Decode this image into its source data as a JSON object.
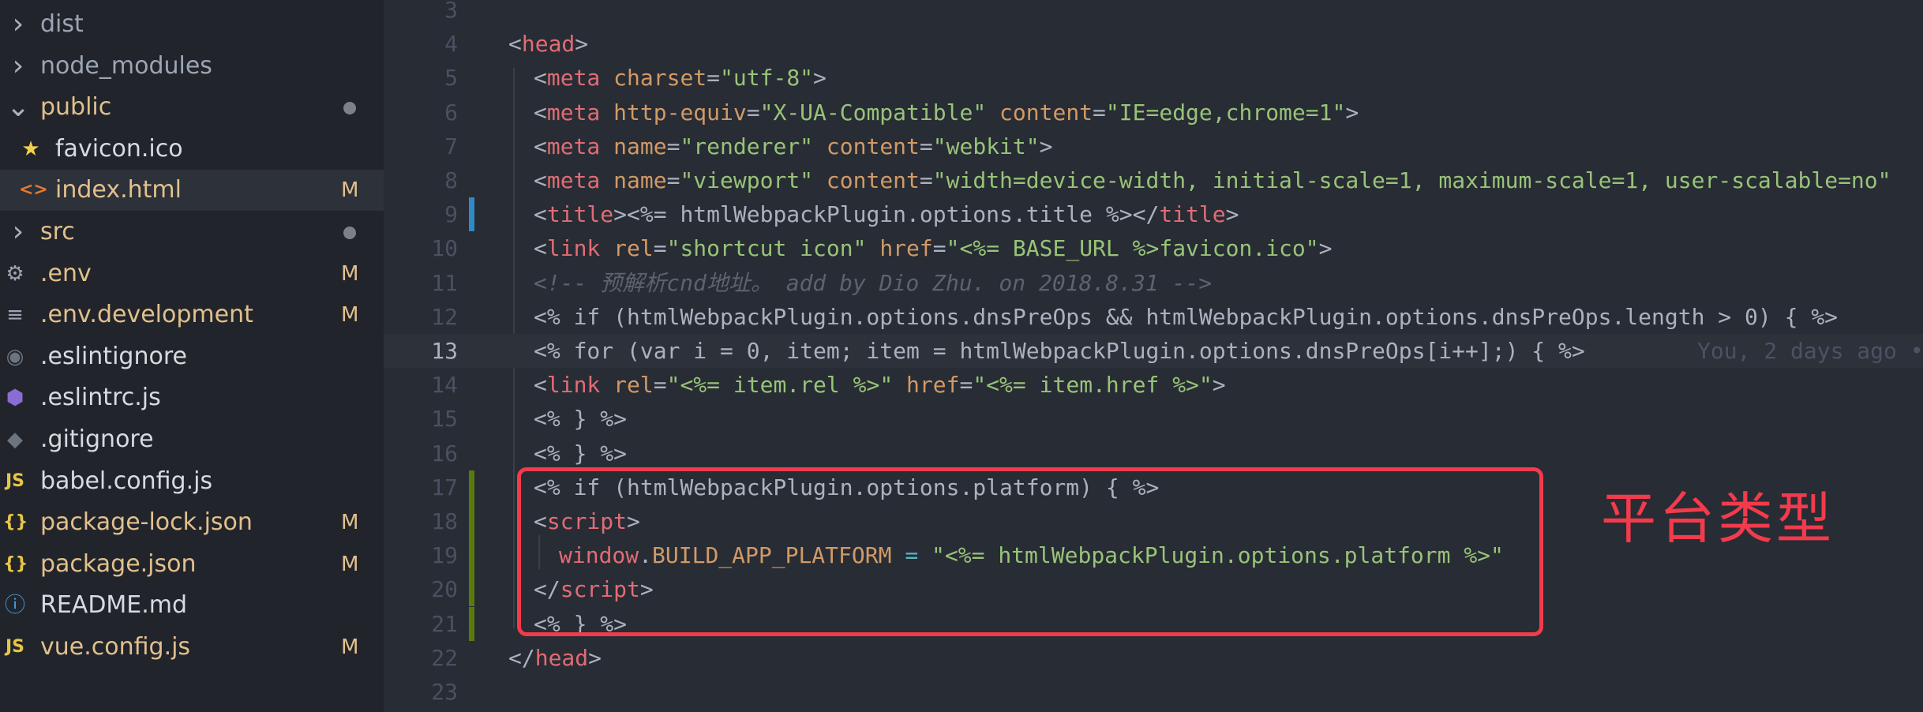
{
  "explorer": {
    "items": [
      {
        "name": "dist",
        "kind": "folder-collapsed",
        "icon": "chevron-right-icon",
        "color": "#9da5b4",
        "badge": ""
      },
      {
        "name": "node_modules",
        "kind": "folder-collapsed",
        "icon": "chevron-right-icon",
        "color": "#9da5b4",
        "badge": ""
      },
      {
        "name": "public",
        "kind": "folder-expanded",
        "icon": "chevron-down-icon",
        "color": "#e2c08d",
        "badge": "dot"
      },
      {
        "name": "favicon.ico",
        "kind": "file",
        "icon": "star-icon",
        "color": "#d7dae0",
        "badge": ""
      },
      {
        "name": "index.html",
        "kind": "file",
        "icon": "html-icon",
        "color": "#e2c08d",
        "badge": "M",
        "selected": true
      },
      {
        "name": "src",
        "kind": "folder-collapsed",
        "icon": "chevron-right-icon",
        "color": "#e2c08d",
        "badge": "dot"
      },
      {
        "name": ".env",
        "kind": "file",
        "icon": "gear-icon",
        "color": "#e2c08d",
        "badge": "M"
      },
      {
        "name": ".env.development",
        "kind": "file",
        "icon": "lines-icon",
        "color": "#e2c08d",
        "badge": "M"
      },
      {
        "name": ".eslintignore",
        "kind": "file",
        "icon": "circle-icon",
        "color": "#d7dae0",
        "badge": ""
      },
      {
        "name": ".eslintrc.js",
        "kind": "file",
        "icon": "eslint-icon",
        "color": "#d7dae0",
        "badge": ""
      },
      {
        "name": ".gitignore",
        "kind": "file",
        "icon": "git-icon",
        "color": "#d7dae0",
        "badge": ""
      },
      {
        "name": "babel.config.js",
        "kind": "file",
        "icon": "js-icon",
        "color": "#d7dae0",
        "badge": ""
      },
      {
        "name": "package-lock.json",
        "kind": "file",
        "icon": "json-icon",
        "color": "#e2c08d",
        "badge": "M"
      },
      {
        "name": "package.json",
        "kind": "file",
        "icon": "json-icon",
        "color": "#e2c08d",
        "badge": "M"
      },
      {
        "name": "README.md",
        "kind": "file",
        "icon": "info-icon",
        "color": "#d7dae0",
        "badge": ""
      },
      {
        "name": "vue.config.js",
        "kind": "file",
        "icon": "js-icon",
        "color": "#e2c08d",
        "badge": "M"
      }
    ]
  },
  "editor": {
    "current_line": 13,
    "lines": [
      {
        "num": "3",
        "indent": 0,
        "tokens": []
      },
      {
        "num": "4",
        "indent": 0,
        "tokens": [
          [
            "p",
            "<"
          ],
          [
            "t",
            "head"
          ],
          [
            "p",
            ">"
          ]
        ]
      },
      {
        "num": "5",
        "indent": 1,
        "tokens": [
          [
            "p",
            "<"
          ],
          [
            "t",
            "meta"
          ],
          [
            "p",
            " "
          ],
          [
            "a",
            "charset"
          ],
          [
            "p",
            "="
          ],
          [
            "s",
            "\"utf-8\""
          ],
          [
            "p",
            ">"
          ]
        ]
      },
      {
        "num": "6",
        "indent": 1,
        "tokens": [
          [
            "p",
            "<"
          ],
          [
            "t",
            "meta"
          ],
          [
            "p",
            " "
          ],
          [
            "a",
            "http-equiv"
          ],
          [
            "p",
            "="
          ],
          [
            "s",
            "\"X-UA-Compatible\""
          ],
          [
            "p",
            " "
          ],
          [
            "a",
            "content"
          ],
          [
            "p",
            "="
          ],
          [
            "s",
            "\"IE=edge,chrome=1\""
          ],
          [
            "p",
            ">"
          ]
        ]
      },
      {
        "num": "7",
        "indent": 1,
        "tokens": [
          [
            "p",
            "<"
          ],
          [
            "t",
            "meta"
          ],
          [
            "p",
            " "
          ],
          [
            "a",
            "name"
          ],
          [
            "p",
            "="
          ],
          [
            "s",
            "\"renderer\""
          ],
          [
            "p",
            " "
          ],
          [
            "a",
            "content"
          ],
          [
            "p",
            "="
          ],
          [
            "s",
            "\"webkit\""
          ],
          [
            "p",
            ">"
          ]
        ]
      },
      {
        "num": "8",
        "indent": 1,
        "tokens": [
          [
            "p",
            "<"
          ],
          [
            "t",
            "meta"
          ],
          [
            "p",
            " "
          ],
          [
            "a",
            "name"
          ],
          [
            "p",
            "="
          ],
          [
            "s",
            "\"viewport\""
          ],
          [
            "p",
            " "
          ],
          [
            "a",
            "content"
          ],
          [
            "p",
            "="
          ],
          [
            "s",
            "\"width=device-width, initial-scale=1, maximum-scale=1, user-scalable=no\""
          ]
        ]
      },
      {
        "num": "9",
        "indent": 1,
        "git": "#2f8ac5",
        "tokens": [
          [
            "p",
            "<"
          ],
          [
            "t",
            "title"
          ],
          [
            "p",
            ">"
          ],
          [
            "p",
            "<%= htmlWebpackPlugin.options.title %>"
          ],
          [
            "p",
            "</"
          ],
          [
            "t",
            "title"
          ],
          [
            "p",
            ">"
          ]
        ]
      },
      {
        "num": "10",
        "indent": 1,
        "tokens": [
          [
            "p",
            "<"
          ],
          [
            "t",
            "link"
          ],
          [
            "p",
            " "
          ],
          [
            "a",
            "rel"
          ],
          [
            "p",
            "="
          ],
          [
            "s",
            "\"shortcut icon\""
          ],
          [
            "p",
            " "
          ],
          [
            "a",
            "href"
          ],
          [
            "p",
            "="
          ],
          [
            "s",
            "\"<%= BASE_URL %>favicon.ico\""
          ],
          [
            "p",
            ">"
          ]
        ]
      },
      {
        "num": "11",
        "indent": 1,
        "tokens": [
          [
            "c",
            "<!-- 预解析cnd地址。 add by Dio Zhu. on 2018.8.31 -->"
          ]
        ]
      },
      {
        "num": "12",
        "indent": 1,
        "tokens": [
          [
            "p",
            "<% if (htmlWebpackPlugin.options.dnsPreOps && htmlWebpackPlugin.options.dnsPreOps.length > 0) { %>"
          ]
        ]
      },
      {
        "num": "13",
        "indent": 1,
        "current": true,
        "blame": "You, 2 days ago •",
        "tokens": [
          [
            "p",
            "<% for (var i = 0, item; item = htmlWebpackPlugin.options.dnsPreOps[i++];) { %>"
          ]
        ]
      },
      {
        "num": "14",
        "indent": 1,
        "tokens": [
          [
            "p",
            "<"
          ],
          [
            "t",
            "link"
          ],
          [
            "p",
            " "
          ],
          [
            "a",
            "rel"
          ],
          [
            "p",
            "="
          ],
          [
            "s",
            "\"<%= item.rel %>\""
          ],
          [
            "p",
            " "
          ],
          [
            "a",
            "href"
          ],
          [
            "p",
            "="
          ],
          [
            "s",
            "\"<%= item.href %>\""
          ],
          [
            "p",
            ">"
          ]
        ]
      },
      {
        "num": "15",
        "indent": 1,
        "tokens": [
          [
            "p",
            "<% } %>"
          ]
        ]
      },
      {
        "num": "16",
        "indent": 1,
        "tokens": [
          [
            "p",
            "<% } %>"
          ]
        ]
      },
      {
        "num": "17",
        "indent": 1,
        "git": "#587c0c",
        "tokens": [
          [
            "p",
            "<% if (htmlWebpackPlugin.options.platform) { %>"
          ]
        ]
      },
      {
        "num": "18",
        "indent": 1,
        "git": "#587c0c",
        "tokens": [
          [
            "p",
            "<"
          ],
          [
            "t",
            "script"
          ],
          [
            "p",
            ">"
          ]
        ]
      },
      {
        "num": "19",
        "indent": 2,
        "git": "#587c0c",
        "tokens": [
          [
            "t",
            "window"
          ],
          [
            "p",
            "."
          ],
          [
            "a",
            "BUILD_APP_PLATFORM"
          ],
          [
            "p",
            " "
          ],
          [
            "o",
            "="
          ],
          [
            "p",
            " "
          ],
          [
            "s",
            "\"<%= htmlWebpackPlugin.options.platform %>\""
          ]
        ]
      },
      {
        "num": "20",
        "indent": 1,
        "git": "#587c0c",
        "tokens": [
          [
            "p",
            "</"
          ],
          [
            "t",
            "script"
          ],
          [
            "p",
            ">"
          ]
        ]
      },
      {
        "num": "21",
        "indent": 1,
        "git": "#587c0c",
        "tokens": [
          [
            "p",
            "<% } %>"
          ]
        ]
      },
      {
        "num": "22",
        "indent": 0,
        "tokens": [
          [
            "p",
            "</"
          ],
          [
            "t",
            "head"
          ],
          [
            "p",
            ">"
          ]
        ]
      },
      {
        "num": "23",
        "indent": 0,
        "tokens": []
      }
    ]
  },
  "annotation": {
    "text": "平台类型",
    "color": "#f23b4c"
  }
}
